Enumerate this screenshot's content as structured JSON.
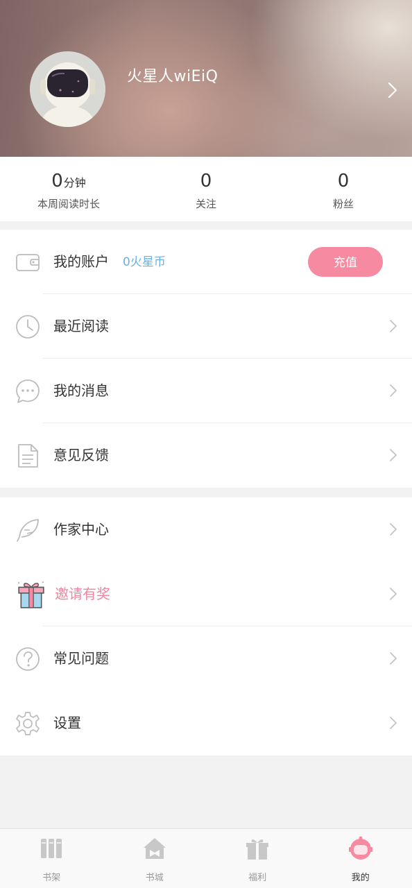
{
  "profile": {
    "username": "火星人wiEiQ"
  },
  "stats": [
    {
      "value": "0",
      "unit": "分钟",
      "label": "本周阅读时长"
    },
    {
      "value": "0",
      "unit": "",
      "label": "关注"
    },
    {
      "value": "0",
      "unit": "",
      "label": "粉丝"
    }
  ],
  "account": {
    "label": "我的账户",
    "balance": "0火星币",
    "recharge_label": "充值"
  },
  "menu1": [
    {
      "label": "最近阅读",
      "icon": "clock-icon"
    },
    {
      "label": "我的消息",
      "icon": "message-icon"
    },
    {
      "label": "意见反馈",
      "icon": "document-icon"
    }
  ],
  "menu2": [
    {
      "label": "作家中心",
      "icon": "feather-icon"
    },
    {
      "label": "邀请有奖",
      "icon": "gift-icon"
    },
    {
      "label": "常见问题",
      "icon": "question-icon"
    },
    {
      "label": "设置",
      "icon": "gear-icon"
    }
  ],
  "tabs": [
    {
      "label": "书架",
      "icon": "bookshelf-icon"
    },
    {
      "label": "书城",
      "icon": "bookstore-icon"
    },
    {
      "label": "福利",
      "icon": "gift-icon"
    },
    {
      "label": "我的",
      "icon": "astronaut-icon",
      "active": true
    }
  ],
  "colors": {
    "accent_pink": "#f58aa1",
    "coin_blue": "#6ab0e8",
    "icon_gray": "#c4c4c4"
  }
}
